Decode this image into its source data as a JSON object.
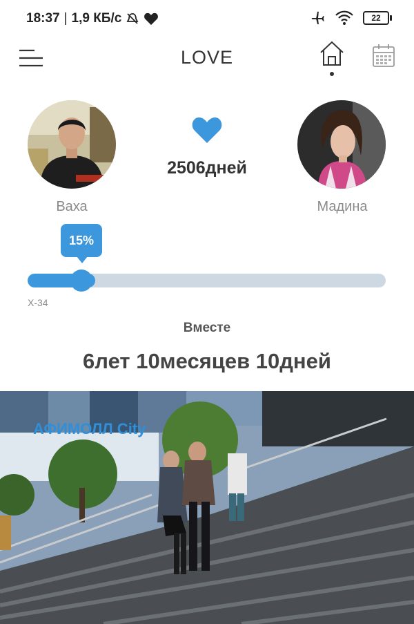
{
  "status_bar": {
    "time": "18:37",
    "separator": "|",
    "speed": "1,9 КБ/с",
    "battery": "22"
  },
  "app": {
    "title": "LOVE",
    "icons": [
      "menu-icon",
      "home-icon",
      "calendar-icon"
    ]
  },
  "couple": {
    "left_name": "Ваха",
    "right_name": "Мадина",
    "days_together": "2506дней"
  },
  "progress": {
    "label": "15%",
    "value_percent": 15,
    "code": "X-34"
  },
  "together_label": "Вместе",
  "duration": "6лет 10месяцев 10дней",
  "photo": {
    "sign_text": "АФИМОЛЛ City"
  },
  "colors": {
    "accent": "#3d97dc",
    "track": "#cdd8e3",
    "text_dark": "#333333",
    "text_muted": "#8a8a8a"
  }
}
